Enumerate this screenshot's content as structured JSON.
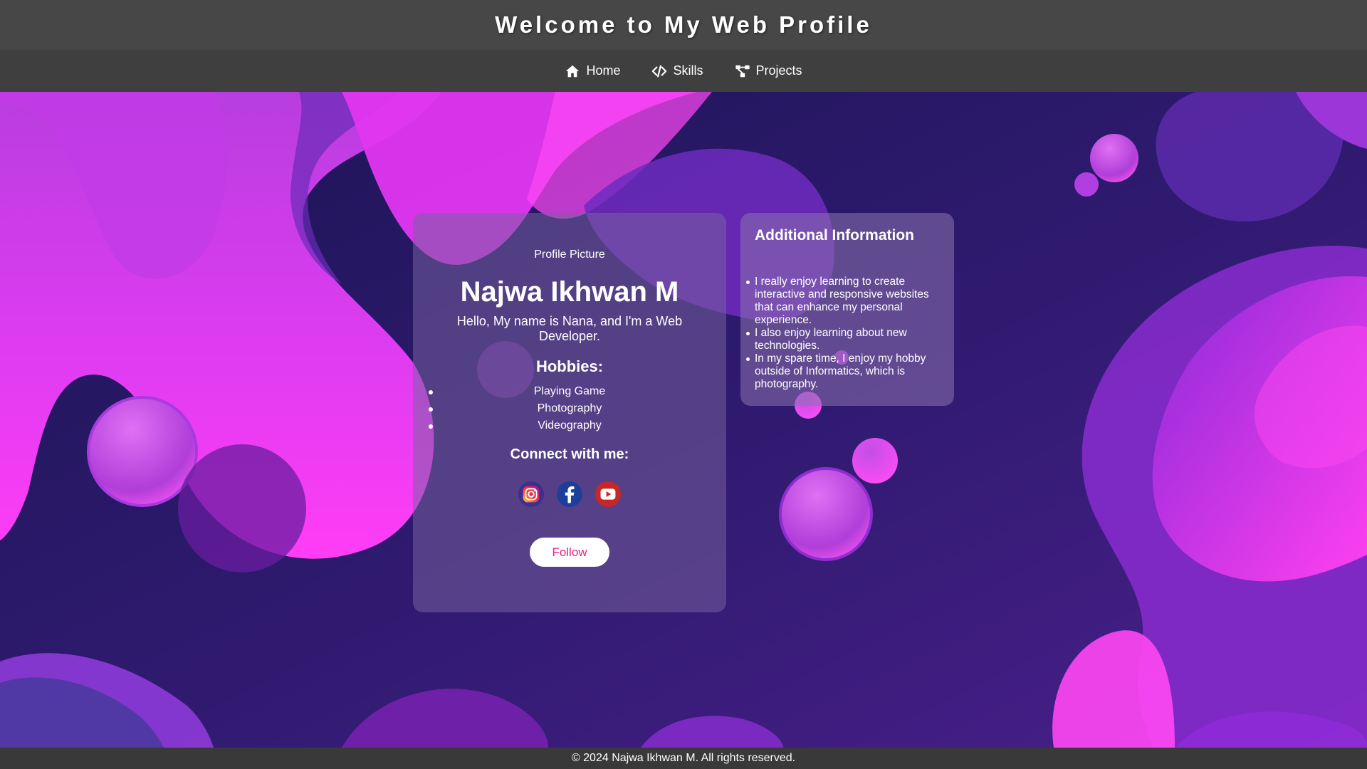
{
  "header": {
    "title": "Welcome to My Web Profile"
  },
  "nav": {
    "items": [
      {
        "label": "Home",
        "icon": "home-icon"
      },
      {
        "label": "Skills",
        "icon": "code-icon"
      },
      {
        "label": "Projects",
        "icon": "project-diagram-icon"
      }
    ]
  },
  "profile": {
    "picture_text": "Profile Picture",
    "name": "Najwa Ikhwan M",
    "intro": "Hello, My name is Nana, and I'm a Web Developer.",
    "hobbies_title": "Hobbies:",
    "hobbies": [
      "Playing Game",
      "Photography",
      "Videography"
    ],
    "connect_title": "Connect with me:",
    "socials": [
      {
        "icon": "instagram-icon"
      },
      {
        "icon": "facebook-icon"
      },
      {
        "icon": "youtube-icon"
      }
    ],
    "follow_label": "Follow"
  },
  "info": {
    "title": "Additional Information",
    "items": [
      "I really enjoy learning to create interactive and responsive websites that can enhance my personal experience.",
      "I also enjoy learning about new technologies.",
      "In my spare time, I enjoy my hobby outside of Informatics, which is photography."
    ]
  },
  "footer": {
    "text": "© 2024 Najwa Ikhwan M. All rights reserved."
  },
  "colors": {
    "header_bg": "#474747",
    "nav_bg": "#3f3f3f",
    "footer_bg": "#393939",
    "accent_pink": "#e91e8c",
    "bg_deep": "#1a1250",
    "bg_magenta": "#e040fb"
  }
}
